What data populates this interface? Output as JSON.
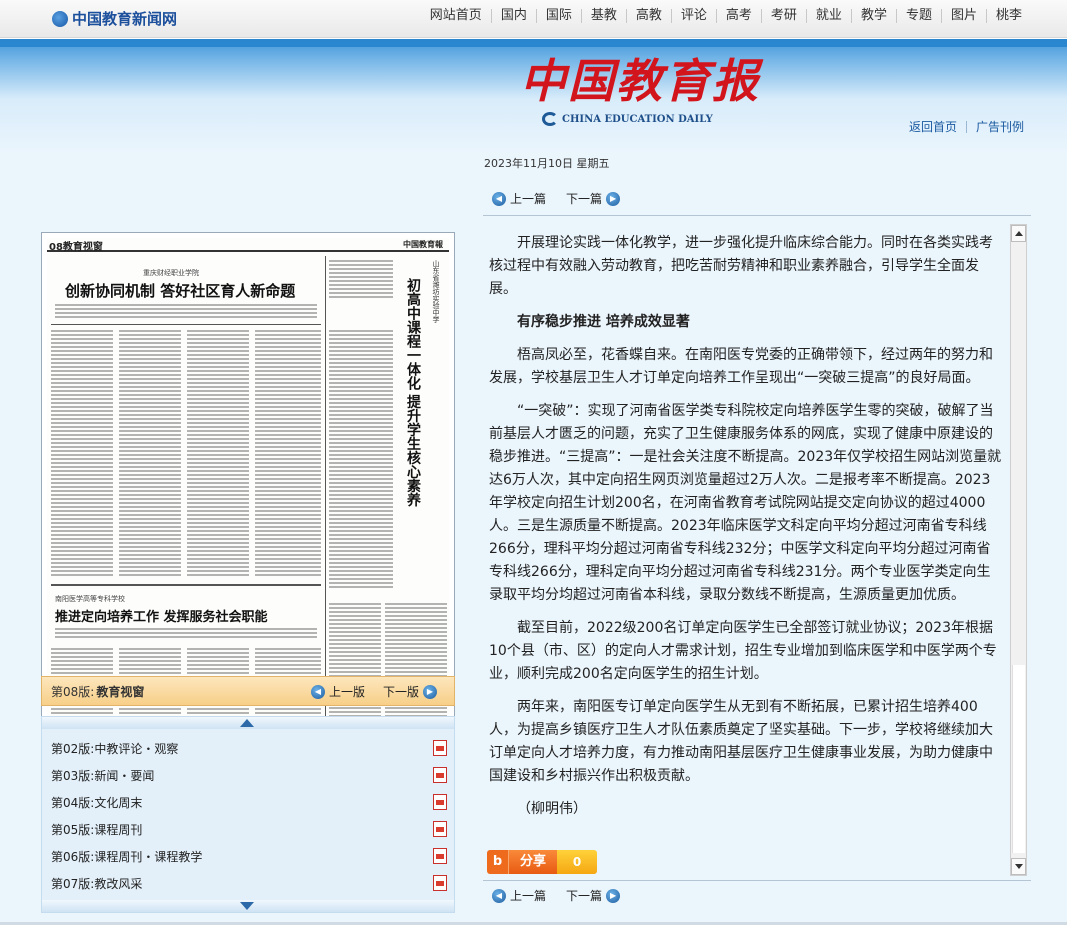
{
  "site": {
    "name": "中国教育新闻网"
  },
  "nav": [
    "网站首页",
    "国内",
    "国际",
    "基教",
    "高教",
    "评论",
    "高考",
    "考研",
    "就业",
    "教学",
    "专题",
    "图片",
    "桃李"
  ],
  "masthead": {
    "cn": "中国教育报",
    "en": "CHINA EDUCATION DAILY"
  },
  "top_links": {
    "home": "返回首页",
    "ads": "广告刊例"
  },
  "date": "2023年11月10日  星期五",
  "article_nav": {
    "prev": "上一篇",
    "next": "下一篇"
  },
  "paper": {
    "page_no": "08教育视窗",
    "paper_name": "中国教育報",
    "headline1_kicker": "重庆财经职业学院",
    "headline1": "创新协同机制 答好社区育人新命题",
    "headline2_kicker": "南阳医学高等专科学校",
    "headline2": "推进定向培养工作 发挥服务社会职能",
    "vertical_kicker": "山东省潍坊实验中学",
    "vertical_title": "初高中课程一体化 提升学生核心素养"
  },
  "edition": {
    "label": "第08版:",
    "name": "教育视窗",
    "prev": "上一版",
    "next": "下一版"
  },
  "editions": [
    {
      "no": "第02版:",
      "name": "中教评论・观察"
    },
    {
      "no": "第03版:",
      "name": "新闻・要闻"
    },
    {
      "no": "第04版:",
      "name": "文化周末"
    },
    {
      "no": "第05版:",
      "name": "课程周刊"
    },
    {
      "no": "第06版:",
      "name": "课程周刊・课程教学"
    },
    {
      "no": "第07版:",
      "name": "教改风采"
    }
  ],
  "article": {
    "p0": "开展理论实践一体化教学，进一步强化提升临床综合能力。同时在各类实践考核过程中有效融入劳动教育，把吃苦耐劳精神和职业素养融合，引导学生全面发展。",
    "subhead": "有序稳步推进 培养成效显著",
    "p1": "梧高凤必至，花香蝶自来。在南阳医专党委的正确带领下，经过两年的努力和发展，学校基层卫生人才订单定向培养工作呈现出“一突破三提高”的良好局面。",
    "p2": "“一突破”：实现了河南省医学类专科院校定向培养医学生零的突破，破解了当前基层人才匮乏的问题，充实了卫生健康服务体系的网底，实现了健康中原建设的稳步推进。“三提高”：一是社会关注度不断提高。2023年仅学校招生网站浏览量就达6万人次，其中定向招生网页浏览量超过2万人次。二是报考率不断提高。2023年学校定向招生计划200名，在河南省教育考试院网站提交定向协议的超过4000人。三是生源质量不断提高。2023年临床医学文科定向平均分超过河南省专科线266分，理科平均分超过河南省专科线232分；中医学文科定向平均分超过河南省专科线266分，理科定向平均分超过河南省专科线231分。两个专业医学类定向生录取平均分均超过河南省本科线，录取分数线不断提高，生源质量更加优质。",
    "p3": "截至目前，2022级200名订单定向医学生已全部签订就业协议；2023年根据10个县（市、区）的定向人才需求计划，招生专业增加到临床医学和中医学两个专业，顺利完成200名定向医学生的招生计划。",
    "p4": "两年来，南阳医专订单定向医学生从无到有不断拓展，已累计招生培养400人，为提高乡镇医疗卫生人才队伍素质奠定了坚实基础。下一步，学校将继续加大订单定向人才培养力度，有力推动南阳基层医疗卫生健康事业发展，为助力健康中国建设和乡村振兴作出积极贡献。",
    "author": "（柳明伟）"
  },
  "share": {
    "icon": "b",
    "label": "分享",
    "count": "0"
  }
}
